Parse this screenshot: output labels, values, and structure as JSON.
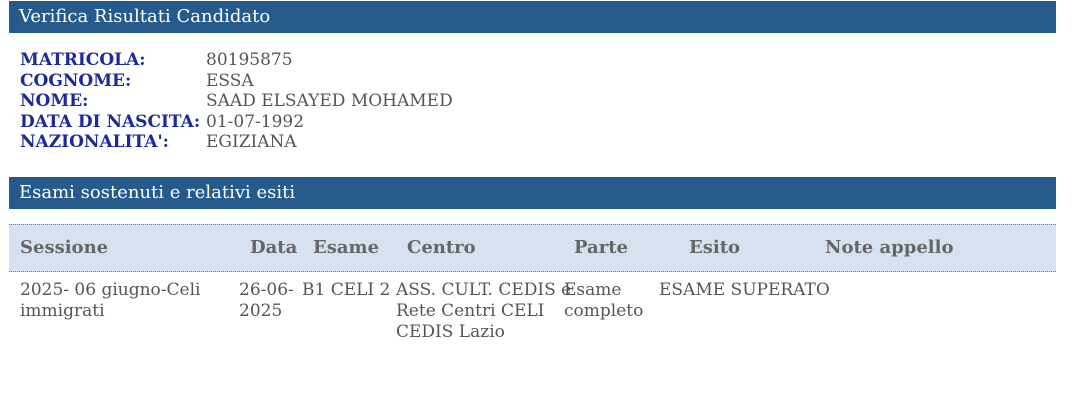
{
  "section1": {
    "title": "Verifica Risultati Candidato"
  },
  "candidate": [
    {
      "label": "MATRICOLA:",
      "value": "80195875"
    },
    {
      "label": "COGNOME:",
      "value": "ESSA"
    },
    {
      "label": "NOME:",
      "value": "SAAD ELSAYED MOHAMED"
    },
    {
      "label": "DATA DI NASCITA:",
      "value": "01-07-1992"
    },
    {
      "label": "NAZIONALITA':",
      "value": "EGIZIANA"
    }
  ],
  "section2": {
    "title": "Esami sostenuti e relativi esiti"
  },
  "table": {
    "headers": {
      "sessione": "Sessione",
      "data": "Data",
      "esame": "Esame",
      "centro": "Centro",
      "parte": "Parte",
      "esito": "Esito",
      "note": "Note appello"
    },
    "rows": [
      {
        "sessione": "2025- 06 giugno-Celi\nimmigrati",
        "data": "26-06-\n2025",
        "esame": "B1 CELI 2",
        "centro": "ASS. CULT. CEDIS e\nRete Centri CELI\nCEDIS Lazio",
        "parte": "Esame\ncompleto",
        "esito": "ESAME SUPERATO",
        "note": ""
      }
    ]
  }
}
